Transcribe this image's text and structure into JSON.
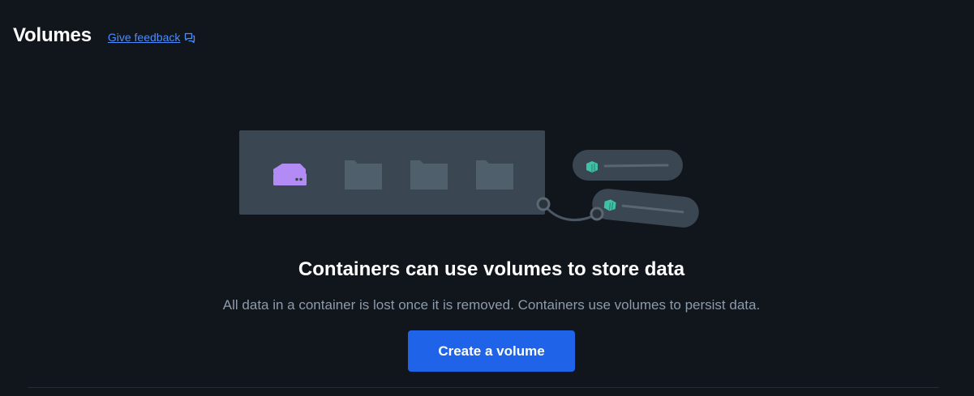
{
  "header": {
    "title": "Volumes",
    "feedback_label": "Give feedback",
    "feedback_icon": "feedback-chat-icon"
  },
  "empty_state": {
    "title": "Containers can use volumes to store data",
    "description": "All data in a container is lost once it is removed. Containers use volumes to persist data.",
    "button_label": "Create a volume"
  },
  "illustration": {
    "icons": [
      "volume-drive-icon",
      "folder-icon",
      "folder-icon",
      "folder-icon",
      "container-icon",
      "container-icon"
    ]
  },
  "colors": {
    "background": "#11151c",
    "primary": "#1f64e8",
    "link": "#4a8dff",
    "drive": "#b38bf5",
    "container": "#3fc1a8",
    "muted_text": "#8c9bab"
  }
}
